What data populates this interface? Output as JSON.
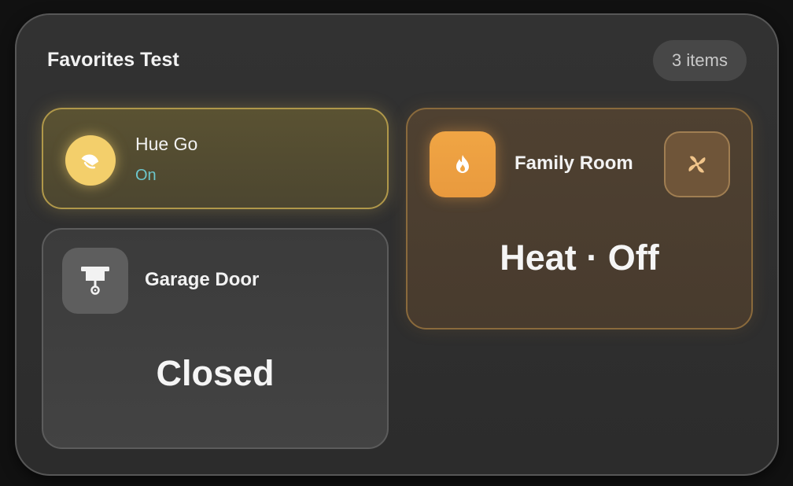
{
  "header": {
    "title": "Favorites Test",
    "count_label": "3 items"
  },
  "cards": {
    "light": {
      "name": "Hue Go",
      "state": "On",
      "icon": "lamp-icon",
      "accent": "#f3cf6b",
      "state_color": "#6cc6cc"
    },
    "garage": {
      "name": "Garage Door",
      "state": "Closed",
      "icon": "garage-door-icon"
    },
    "climate": {
      "name": "Family Room",
      "state": "Heat · Off",
      "icon": "flame-icon",
      "secondary_icon": "fan-icon",
      "accent": "#f0a544"
    }
  }
}
